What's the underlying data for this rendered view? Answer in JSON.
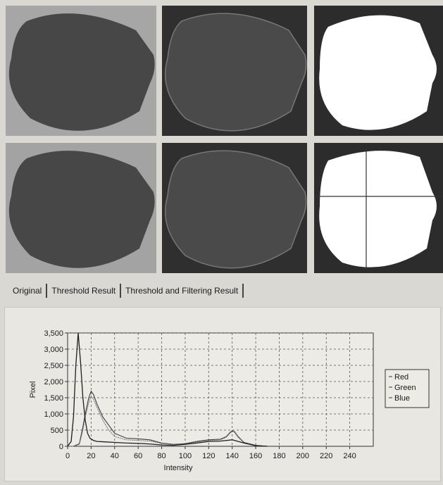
{
  "tabs": [
    {
      "label": "Original"
    },
    {
      "label": "Threshold Result"
    },
    {
      "label": "Threshold and Filtering Result"
    }
  ],
  "images": [
    {
      "row": 1,
      "col": 1,
      "kind": "original-grayscale"
    },
    {
      "row": 1,
      "col": 2,
      "kind": "enhanced-dark"
    },
    {
      "row": 1,
      "col": 3,
      "kind": "threshold-mask"
    },
    {
      "row": 2,
      "col": 1,
      "kind": "original-grayscale"
    },
    {
      "row": 2,
      "col": 2,
      "kind": "enhanced-dark"
    },
    {
      "row": 2,
      "col": 3,
      "kind": "threshold-mask-crosshair"
    }
  ],
  "chart_data": {
    "type": "line",
    "xlabel": "Intensity",
    "ylabel": "Pixel",
    "xlim": [
      0,
      260
    ],
    "ylim": [
      0,
      3500
    ],
    "x_ticks": [
      0,
      20,
      40,
      60,
      80,
      100,
      120,
      140,
      160,
      180,
      200,
      220,
      240
    ],
    "y_ticks": [
      0,
      500,
      1000,
      1500,
      2000,
      2500,
      3000,
      3500
    ],
    "y_tick_labels": [
      "0",
      "500",
      "1,000",
      "1,500",
      "2,000",
      "2,500",
      "3,000",
      "3,500"
    ],
    "grid": true,
    "legend_position": "right",
    "series": [
      {
        "name": "Red",
        "x": [
          0,
          5,
          10,
          13,
          15,
          18,
          20,
          22,
          25,
          30,
          35,
          40,
          50,
          60,
          70,
          80,
          90,
          100,
          110,
          120,
          130,
          135,
          138,
          140,
          142,
          145,
          150,
          160,
          170
        ],
        "y": [
          0,
          0,
          80,
          600,
          1000,
          1500,
          1700,
          1600,
          1300,
          900,
          650,
          400,
          250,
          230,
          200,
          100,
          60,
          80,
          150,
          200,
          220,
          300,
          420,
          480,
          450,
          300,
          120,
          30,
          0
        ]
      },
      {
        "name": "Green",
        "x": [
          0,
          5,
          10,
          13,
          15,
          18,
          20,
          22,
          25,
          30,
          35,
          40,
          50,
          60,
          70,
          80,
          90,
          100,
          110,
          120,
          130,
          135,
          138,
          140,
          142,
          145,
          150,
          160,
          170
        ],
        "y": [
          0,
          0,
          60,
          500,
          900,
          1350,
          1550,
          1450,
          1200,
          800,
          500,
          300,
          200,
          180,
          160,
          90,
          50,
          70,
          130,
          180,
          200,
          280,
          400,
          460,
          430,
          280,
          110,
          20,
          0
        ]
      },
      {
        "name": "Blue",
        "x": [
          0,
          3,
          5,
          7,
          9,
          11,
          13,
          15,
          17,
          19,
          22,
          25,
          30,
          40,
          50,
          60,
          70,
          80,
          90,
          100,
          110,
          120,
          130,
          140,
          150,
          160,
          170
        ],
        "y": [
          0,
          150,
          900,
          2500,
          3500,
          2600,
          1500,
          800,
          400,
          250,
          180,
          150,
          140,
          120,
          100,
          90,
          70,
          40,
          30,
          60,
          100,
          150,
          160,
          200,
          100,
          20,
          0
        ]
      }
    ]
  },
  "colors": {
    "panel_bg": "#e8e7e2",
    "grid": "#555555",
    "plot_line": "#2a2a2a",
    "mask_white": "#ffffff",
    "dark_bg": "#2c2c2c"
  }
}
